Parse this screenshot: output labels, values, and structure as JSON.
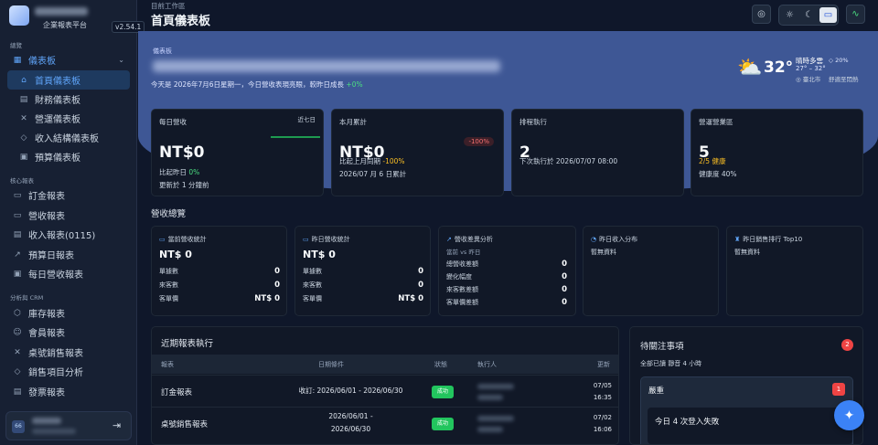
{
  "brand": {
    "name": "",
    "subtitle": "企業報表平台",
    "version": "v2.54.1"
  },
  "sidebar": {
    "section_overview": "總覽",
    "dashboard_group": "儀表板",
    "dashboard_items": [
      {
        "label": "首頁儀表板",
        "icon": "home-icon"
      },
      {
        "label": "財務儀表板",
        "icon": "document-icon"
      },
      {
        "label": "營運儀表板",
        "icon": "tools-icon"
      },
      {
        "label": "收入結構儀表板",
        "icon": "tag-icon"
      },
      {
        "label": "預算儀表板",
        "icon": "calendar-icon"
      }
    ],
    "section_core": "核心報表",
    "core_items": [
      {
        "label": "訂金報表",
        "icon": "card-icon"
      },
      {
        "label": "營收報表",
        "icon": "money-icon"
      },
      {
        "label": "收入報表(0115)",
        "icon": "document-icon"
      },
      {
        "label": "預算日報表",
        "icon": "trend-icon"
      },
      {
        "label": "每日營收報表",
        "icon": "calendar-icon"
      }
    ],
    "section_crm": "分析與 CRM",
    "crm_items": [
      {
        "label": "庫存報表",
        "icon": "box-icon"
      },
      {
        "label": "會員報表",
        "icon": "users-icon"
      },
      {
        "label": "桌號銷售報表",
        "icon": "tools-icon"
      },
      {
        "label": "銷售項目分析",
        "icon": "tag-icon"
      },
      {
        "label": "發票報表",
        "icon": "invoice-icon"
      }
    ],
    "user_initials": "66",
    "logout_icon": "logout-icon"
  },
  "header": {
    "breadcrumb": "目前工作區",
    "title": "首頁儀表板"
  },
  "hero": {
    "label": "儀表板",
    "date_text": "今天是 2026年7月6日星期一，今日營收表現亮眼，較昨日成長",
    "date_growth": "+0%"
  },
  "weather": {
    "icon": "partly-cloudy-icon",
    "temp": "32°",
    "desc": "晴時多雲",
    "rain": "20%",
    "range": "27° – 32°",
    "location": "臺北市",
    "comfort": "舒適至悶熱"
  },
  "kpis": [
    {
      "label": "每日營收",
      "range": "近七日",
      "value": "NT$0",
      "line1_prefix": "比起昨日",
      "line1_val": "0%",
      "line2": "更新於 1 分鐘前"
    },
    {
      "label": "本月累計",
      "badge": "-100%",
      "value": "NT$0",
      "line1_prefix": "比起上月同期",
      "line1_val": "-100%",
      "line2": "2026/07 月 6 日累計"
    },
    {
      "label": "排程執行",
      "value": "2",
      "line1": "下次執行於 2026/07/07 08:00"
    },
    {
      "label": "營運營業區",
      "value": "5",
      "line1_val": "2/5 健康",
      "line2": "健康度 40%"
    }
  ],
  "revenue_section": {
    "title": "營收總覽"
  },
  "mini_cards": [
    {
      "title": "當前營收統計",
      "value": "NT$ 0",
      "rows": [
        {
          "label": "單據數",
          "value": "0"
        },
        {
          "label": "來客數",
          "value": "0"
        },
        {
          "label": "客單價",
          "value": "NT$ 0"
        }
      ]
    },
    {
      "title": "昨日營收統計",
      "value": "NT$ 0",
      "rows": [
        {
          "label": "單據數",
          "value": "0"
        },
        {
          "label": "來客數",
          "value": "0"
        },
        {
          "label": "客單價",
          "value": "NT$ 0"
        }
      ]
    },
    {
      "title": "營收差異分析",
      "subtitle": "當前 vs 昨日",
      "rows": [
        {
          "label": "總營收差額",
          "value": "0"
        },
        {
          "label": "變化幅度",
          "value": "0"
        },
        {
          "label": "來客數差額",
          "value": "0"
        },
        {
          "label": "客單價差額",
          "value": "0"
        }
      ]
    },
    {
      "title": "昨日收入分布",
      "empty": "暫無資料"
    },
    {
      "title": "昨日銷售排行 Top10",
      "empty": "暫無資料"
    }
  ],
  "recent_runs": {
    "title": "近期報表執行",
    "columns": [
      "報表",
      "日期條件",
      "狀態",
      "執行人",
      "更新"
    ],
    "rows": [
      {
        "report": "訂金報表",
        "date": "收訂: 2026/06/01 - 2026/06/30",
        "status": "成功",
        "updated_date": "07/05",
        "updated_time": "16:35"
      },
      {
        "report": "桌號銷售報表",
        "date_line1": "2026/06/01 -",
        "date_line2": "2026/06/30",
        "status": "成功",
        "updated_date": "07/02",
        "updated_time": "16:06"
      }
    ]
  },
  "pending": {
    "title": "待關注事項",
    "count": "2",
    "actions": "全部已讀    靜音 4 小時",
    "group_title": "嚴重",
    "group_count": "1",
    "item": "今日 4 次登入失敗"
  }
}
